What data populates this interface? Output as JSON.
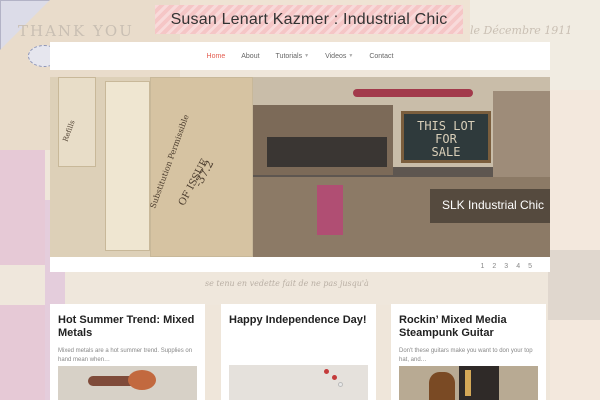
{
  "background": {
    "scrap_text_1": "THANK YOU",
    "scrap_text_2": "le Décembre 1911",
    "scrap_text_3": "se tenu en vedette fait de ne pas jusqu'à"
  },
  "site": {
    "title": "Susan Lenart Kazmer : Industrial Chic",
    "accent_color": "#e35d50"
  },
  "nav": {
    "items": [
      {
        "label": "Home",
        "active": true,
        "has_submenu": false
      },
      {
        "label": "About",
        "active": false,
        "has_submenu": false
      },
      {
        "label": "Tutorials",
        "active": false,
        "has_submenu": true
      },
      {
        "label": "Videos",
        "active": false,
        "has_submenu": true
      },
      {
        "label": "Contact",
        "active": false,
        "has_submenu": false
      }
    ],
    "submenu_icon": "chevron-down-icon"
  },
  "slider": {
    "caption": "SLK Industrial Chic",
    "sign_text": "THIS LOT\nFOR\nSALE",
    "ink_texts": [
      "Substitution Permissible",
      "OF ISSUE",
      "-37.2",
      "Refills"
    ],
    "pages": [
      "1",
      "2",
      "3",
      "4",
      "5"
    ],
    "current_page": 1
  },
  "posts": [
    {
      "title": "Hot Summer Trend: Mixed Metals",
      "excerpt": "Mixed metals are a hot summer trend. Supplies on hand mean when…"
    },
    {
      "title": "Happy Independence Day!",
      "excerpt": ""
    },
    {
      "title": "Rockin’ Mixed Media Steampunk Guitar",
      "excerpt": "Don't these guitars make you want to don your top hat, and…"
    }
  ]
}
